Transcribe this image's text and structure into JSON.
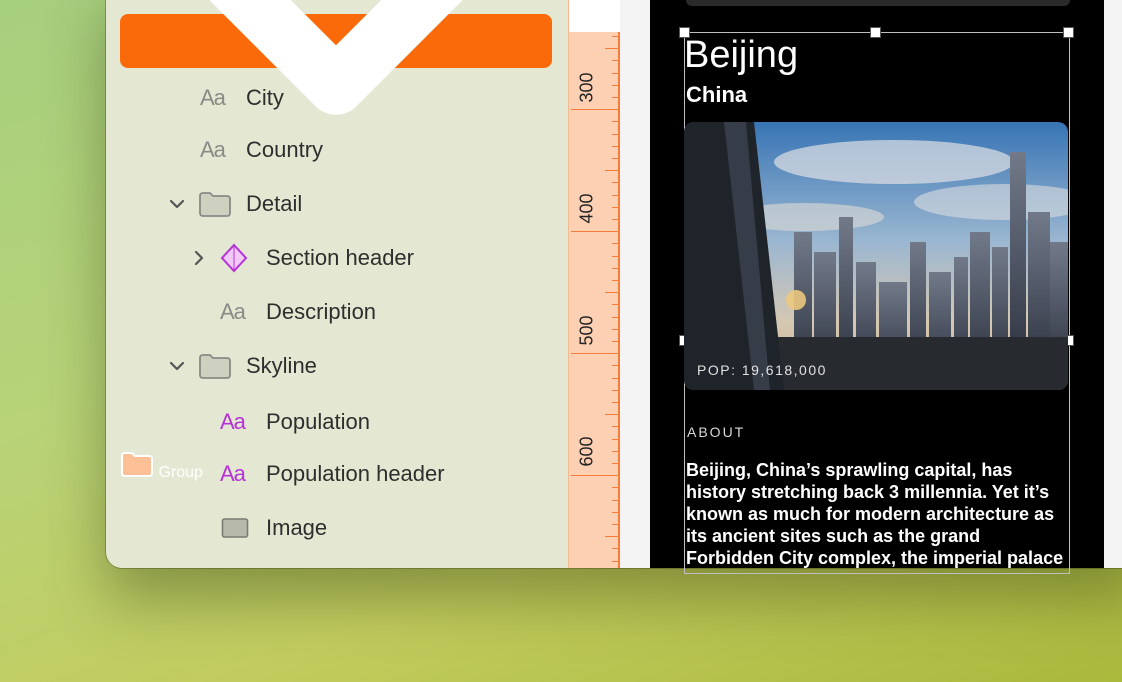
{
  "layers": {
    "group": {
      "label": "Group"
    },
    "items": [
      {
        "label": "City",
        "icon": "text-icon"
      },
      {
        "label": "Country",
        "icon": "text-icon"
      },
      {
        "label": "Detail",
        "icon": "folder-icon"
      },
      {
        "label": "Section header",
        "icon": "component-icon"
      },
      {
        "label": "Description",
        "icon": "text-icon"
      },
      {
        "label": "Skyline",
        "icon": "folder-icon"
      },
      {
        "label": "Population",
        "icon": "text-icon"
      },
      {
        "label": "Population header",
        "icon": "text-icon"
      },
      {
        "label": "Image",
        "icon": "image-icon"
      }
    ],
    "text_icon_glyph": "Aa"
  },
  "ruler": {
    "labels": [
      "300",
      "400",
      "500",
      "600"
    ]
  },
  "preview": {
    "city": "Beijing",
    "country": "China",
    "population": "POP: 19,618,000",
    "about_heading": "ABOUT",
    "description": "Beijing, China’s sprawling capital, has history stretching back 3 millennia. Yet it’s known as much for modern architecture as its ancient sites such as the grand Forbidden City complex, the imperial palace"
  },
  "colors": {
    "selection": "#fb6a0a",
    "sidebar_bg": "#e4e8d2",
    "component_purple": "#b532d8",
    "ruler_bg": "#fdd0b4"
  }
}
